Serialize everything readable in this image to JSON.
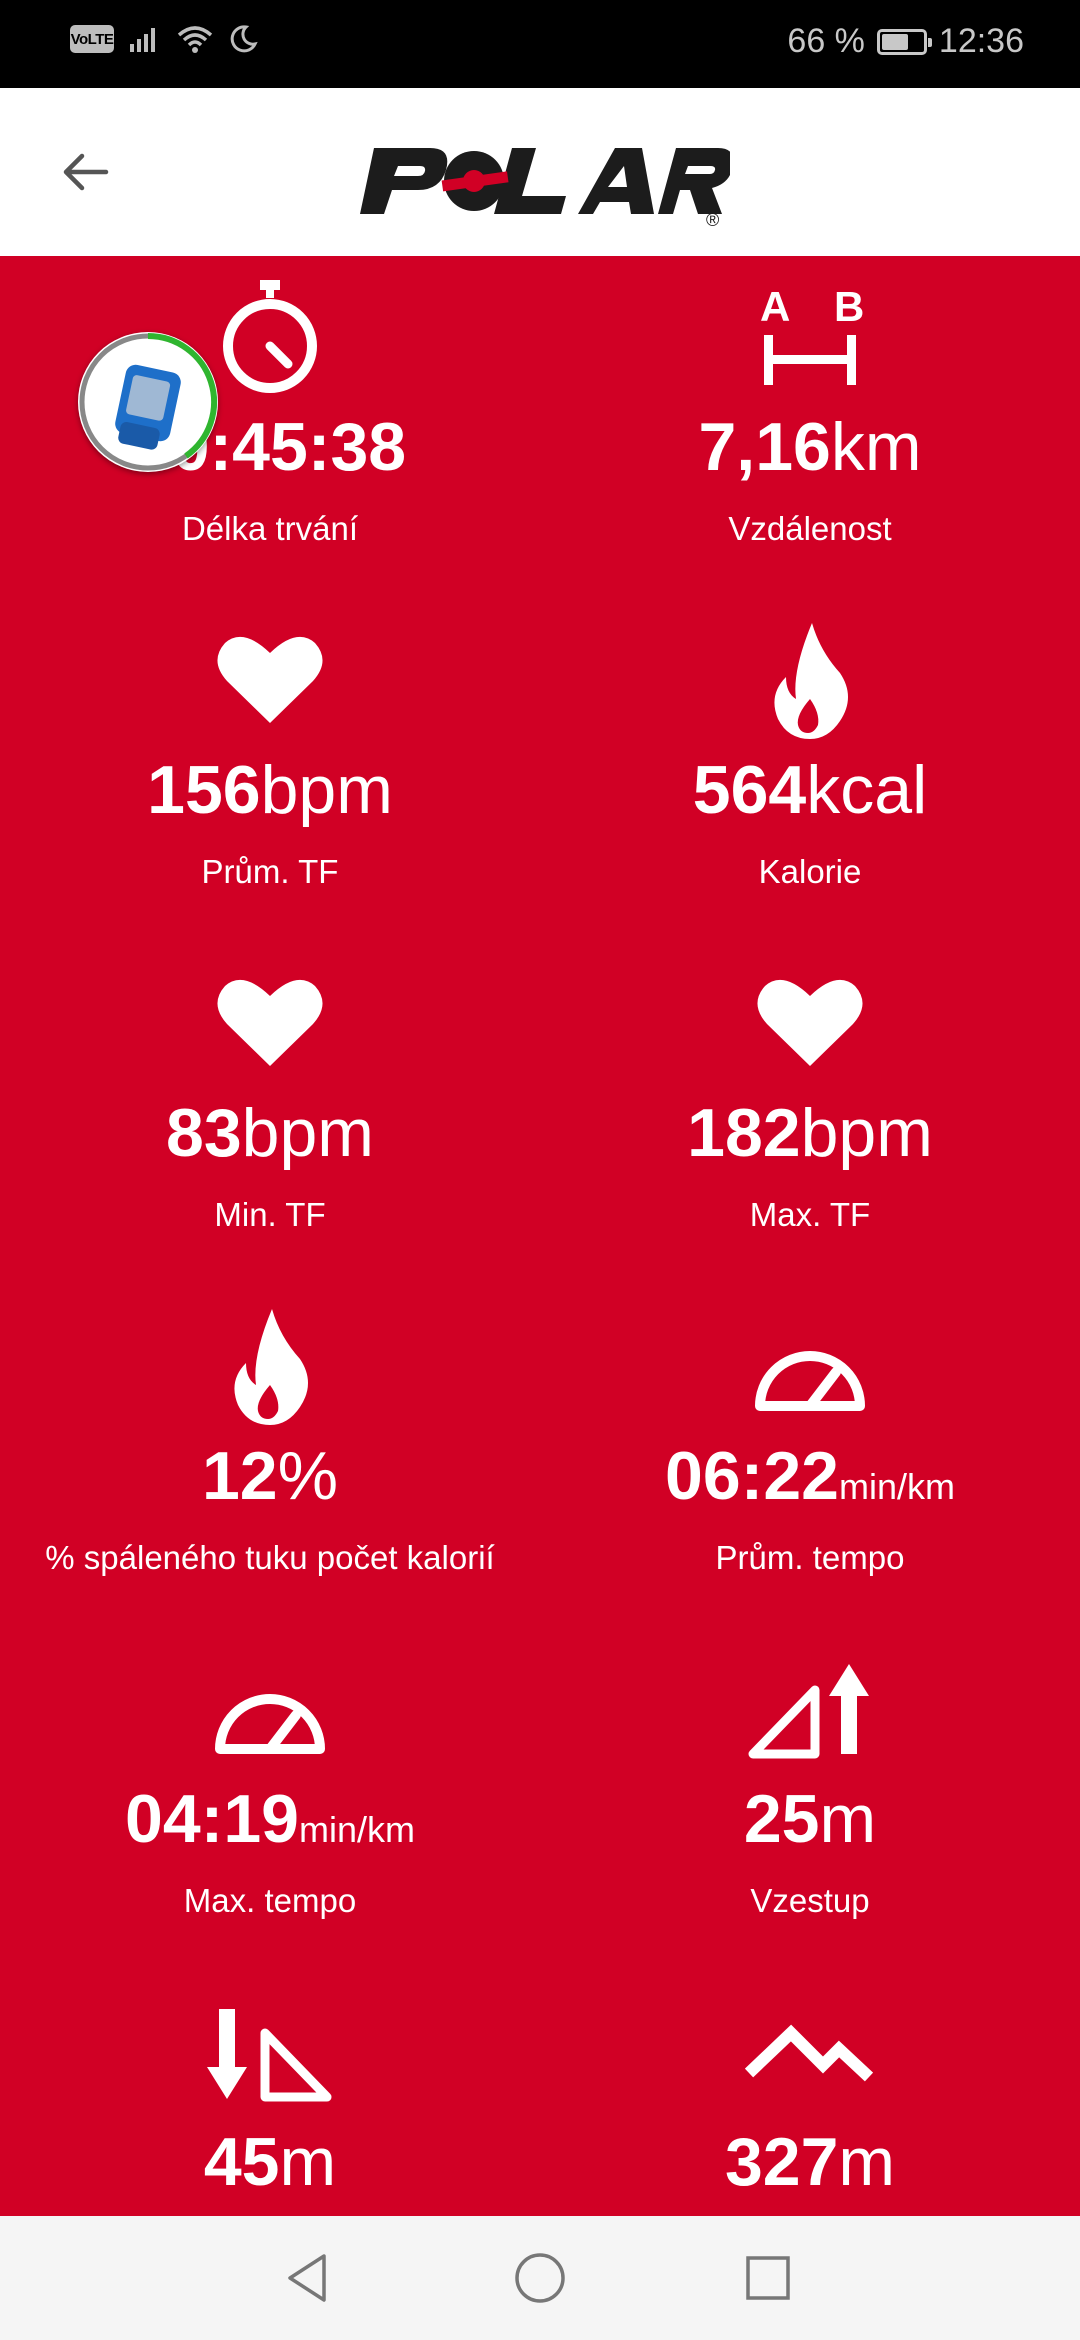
{
  "status_bar": {
    "volte": "VoLTE",
    "battery_percent": "66 %",
    "battery_level": 0.66,
    "time": "12:36"
  },
  "header": {
    "brand": "POLAR",
    "registered_mark": "®"
  },
  "stats": [
    {
      "id": "duration",
      "icon": "stopwatch-icon",
      "number": "00:45:38",
      "unit": "",
      "label": "Délka trvání"
    },
    {
      "id": "distance",
      "icon": "distance-ab-icon",
      "number": "7,16",
      "unit": "km",
      "label": "Vzdálenost"
    },
    {
      "id": "avg-hr",
      "icon": "heart-icon",
      "number": "156",
      "unit": "bpm",
      "label": "Prům. TF"
    },
    {
      "id": "calories",
      "icon": "flame-icon",
      "number": "564",
      "unit": "kcal",
      "label": "Kalorie"
    },
    {
      "id": "min-hr",
      "icon": "heart-icon",
      "number": "83",
      "unit": "bpm",
      "label": "Min. TF"
    },
    {
      "id": "max-hr",
      "icon": "heart-icon",
      "number": "182",
      "unit": "bpm",
      "label": "Max. TF"
    },
    {
      "id": "fat-burn",
      "icon": "flame-icon",
      "number": "12",
      "unit": "%",
      "label": "% spáleného tuku počet kalorií"
    },
    {
      "id": "avg-pace",
      "icon": "speedometer-icon",
      "number": "06:22",
      "unit": "min/km",
      "label": "Prům. tempo"
    },
    {
      "id": "max-pace",
      "icon": "speedometer-icon",
      "number": "04:19",
      "unit": "min/km",
      "label": "Max. tempo"
    },
    {
      "id": "ascent",
      "icon": "ascent-icon",
      "number": "25",
      "unit": "m",
      "label": "Vzestup"
    },
    {
      "id": "descent",
      "icon": "descent-icon",
      "number": "45",
      "unit": "m",
      "label": ""
    },
    {
      "id": "altitude",
      "icon": "mountain-icon",
      "number": "327",
      "unit": "m",
      "label": ""
    }
  ],
  "colors": {
    "background": "#d10025",
    "header": "#ffffff",
    "avatar_ring": "#2fb52f"
  }
}
